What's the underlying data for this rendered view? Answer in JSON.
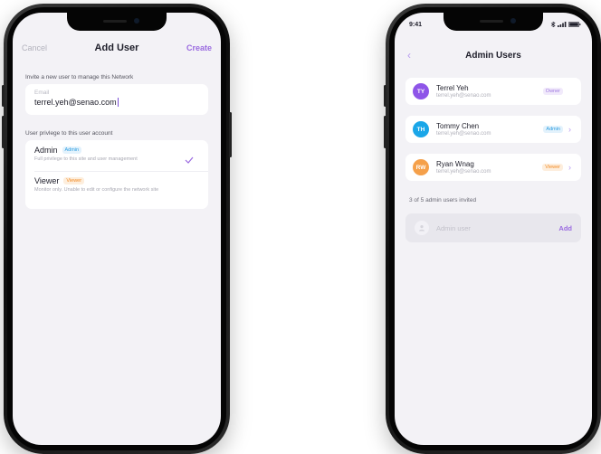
{
  "add_user": {
    "cancel_label": "Cancel",
    "title": "Add User",
    "create_label": "Create",
    "invite_label": "Invite a new user to manage this Network",
    "email_label": "Email",
    "email_value": "terrel.yeh@senao.com",
    "privilege_label": "User privlege to this user account",
    "roles": [
      {
        "name": "Admin",
        "badge": "Admin",
        "desc": "Full privilege to this site and user management",
        "selected": true
      },
      {
        "name": "Viewer",
        "badge": "Viewer",
        "desc": "Monitor only. Unable to edit or configure the network site",
        "selected": false
      }
    ]
  },
  "admin_users": {
    "time": "9:41",
    "back_icon": "chevron-left-icon",
    "title": "Admin Users",
    "users": [
      {
        "initials": "TY",
        "name": "Terrel Yeh",
        "email": "terrel.yeh@senao.com",
        "role": "Owner",
        "avatar_color": "#8e55e8"
      },
      {
        "initials": "TH",
        "name": "Tommy Chen",
        "email": "terrel.yeh@senao.com",
        "role": "Admin",
        "avatar_color": "#1aa6e8"
      },
      {
        "initials": "RW",
        "name": "Ryan Wnag",
        "email": "terrel.yeh@senao.com",
        "role": "Viewer",
        "avatar_color": "#f5a04a"
      }
    ],
    "invited_text": "3 of 5 admin users invited",
    "add_placeholder": "Admin user",
    "add_label": "Add"
  },
  "colors": {
    "accent": "#9a6ae0",
    "admin": "#2c9de0",
    "viewer": "#f28a23",
    "owner": "#a07ae0"
  }
}
